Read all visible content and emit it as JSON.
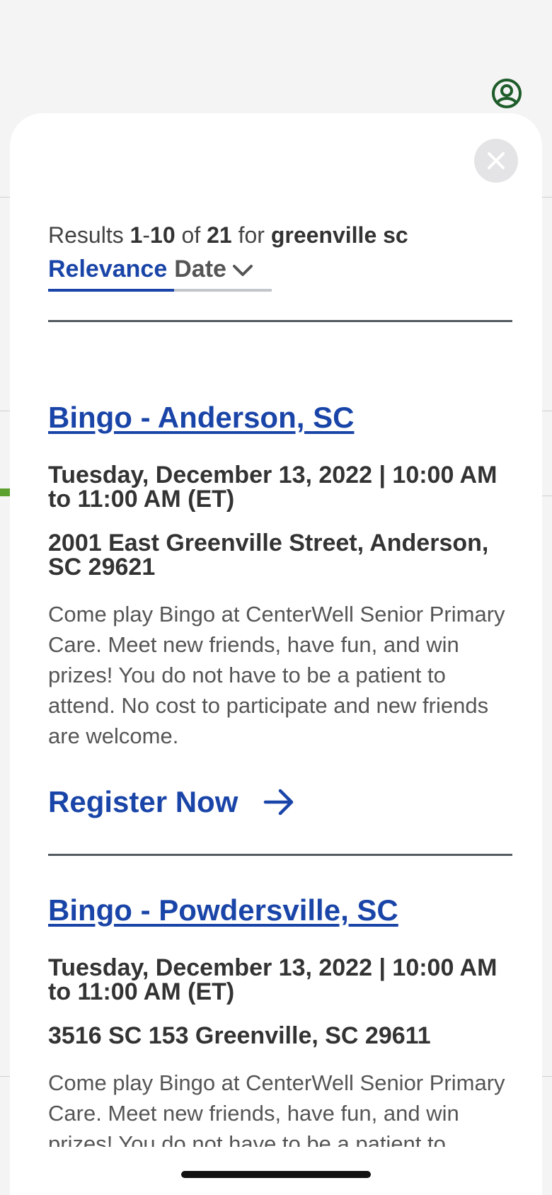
{
  "header": {
    "account_icon": "account-circle-icon"
  },
  "results": {
    "prefix": "Results ",
    "range_start": "1",
    "range_sep": "-",
    "range_end": "10",
    "of_text": " of ",
    "total": "21",
    "for_text": " for ",
    "query": "greenville sc"
  },
  "sort": {
    "relevance_label": "Relevance",
    "date_label": "Date"
  },
  "events": [
    {
      "title": "Bingo - Anderson, SC",
      "date": "Tuesday, December 13, 2022 | 10:00 AM to 11:00 AM (ET)",
      "address": "2001 East Greenville Street, Anderson, SC 29621",
      "description": "Come play Bingo at CenterWell Senior Primary Care. Meet new friends, have fun, and win prizes! You do not have to be a patient to attend. No cost to participate and new friends are welcome.",
      "register_label": "Register Now"
    },
    {
      "title": "Bingo - Powdersville, SC",
      "date": "Tuesday, December 13, 2022 | 10:00 AM to 11:00 AM (ET)",
      "address": "3516 SC 153 Greenville, SC 29611",
      "description": "Come play Bingo at CenterWell Senior Primary Care. Meet new friends, have fun, and win prizes! You do not have to be a patient to attend."
    }
  ],
  "colors": {
    "link_blue": "#1a45a8",
    "account_green": "#1e5c2a",
    "accent_green": "#5ba02e"
  }
}
